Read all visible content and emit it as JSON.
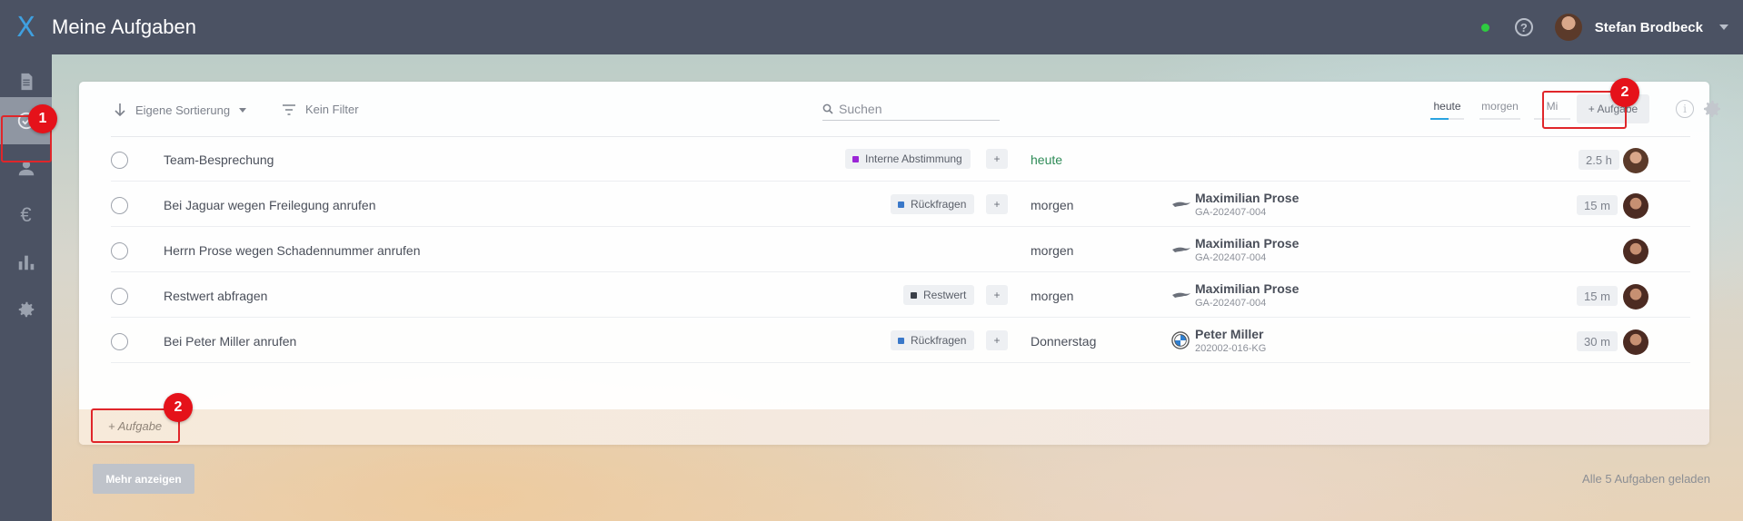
{
  "app": {
    "logo_glyph": "X",
    "title": "Meine Aufgaben"
  },
  "header": {
    "status": "online",
    "help_glyph": "?",
    "user_name": "Stefan Brodbeck"
  },
  "sidebar": {
    "items": [
      {
        "name": "documents",
        "icon": "document-icon"
      },
      {
        "name": "tasks",
        "icon": "check-circle-icon",
        "active": true
      },
      {
        "name": "contacts",
        "icon": "person-icon"
      },
      {
        "name": "finance",
        "icon": "euro-icon",
        "glyph": "€"
      },
      {
        "name": "statistics",
        "icon": "bar-chart-icon"
      },
      {
        "name": "settings",
        "icon": "gear-icon"
      }
    ]
  },
  "annotations": {
    "badge_1": "1",
    "badge_2_top": "2",
    "badge_2_bottom": "2",
    "color": "#e0262a"
  },
  "toolbar": {
    "sort_label": "Eigene Sortierung",
    "filter_label": "Kein Filter",
    "search_placeholder": "Suchen",
    "day_tabs": [
      "heute",
      "morgen",
      "Mi"
    ],
    "add_task_label": "+ Aufgabe",
    "info_glyph": "i"
  },
  "tasks": [
    {
      "title": "Team-Besprechung",
      "tag": "Interne Abstimmung",
      "tag_color": "#9b26d6",
      "plus": "+",
      "due": "heute",
      "ref_name": "",
      "ref_id": "",
      "duration": "2.5 h"
    },
    {
      "title": "Bei Jaguar wegen Freilegung anrufen",
      "tag": "Rückfragen",
      "tag_color": "#3a78c9",
      "plus": "+",
      "due": "morgen",
      "ref_name": "Maximilian Prose",
      "ref_id": "GA-202407-004",
      "ref_icon": "jaguar-logo-icon",
      "duration": "15 m"
    },
    {
      "title": "Herrn Prose wegen Schadennummer anrufen",
      "tag": "",
      "due": "morgen",
      "ref_name": "Maximilian Prose",
      "ref_id": "GA-202407-004",
      "ref_icon": "jaguar-logo-icon",
      "duration": ""
    },
    {
      "title": "Restwert abfragen",
      "tag": "Restwert",
      "tag_color": "#3a3f48",
      "plus": "+",
      "due": "morgen",
      "ref_name": "Maximilian Prose",
      "ref_id": "GA-202407-004",
      "ref_icon": "jaguar-logo-icon",
      "duration": "15 m"
    },
    {
      "title": "Bei Peter Miller anrufen",
      "tag": "Rückfragen",
      "tag_color": "#3a78c9",
      "plus": "+",
      "due": "Donnerstag",
      "ref_name": "Peter Miller",
      "ref_id": "202002-016-KG",
      "ref_icon": "bmw-logo-icon",
      "duration": "30 m"
    }
  ],
  "footer": {
    "add_task_label": "+ Aufgabe",
    "more_label": "Mehr anzeigen",
    "loaded_text": "Alle 5 Aufgaben geladen"
  }
}
